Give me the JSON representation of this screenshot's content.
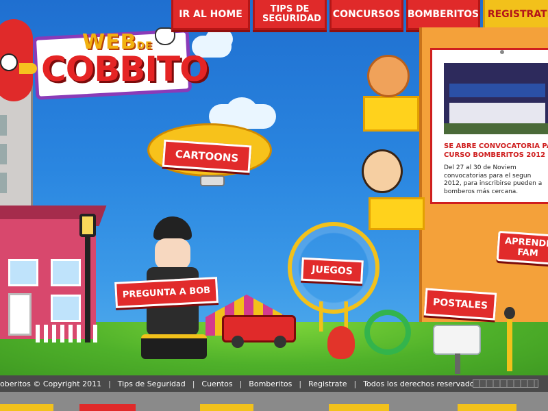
{
  "nav": {
    "items": [
      {
        "label": "IR AL HOME"
      },
      {
        "label": "TIPS DE SEGURIDAD"
      },
      {
        "label": "CONCURSOS"
      },
      {
        "label": "BOMBERITOS"
      },
      {
        "label": "REGISTRATE"
      }
    ]
  },
  "logo": {
    "web": "WEB",
    "de": "DE",
    "name": "COBBITO"
  },
  "signs": {
    "cartoons": "CARTOONS",
    "pregunta": "PREGUNTA A BOB",
    "juegos": "JUEGOS",
    "postales": "POSTALES",
    "aprende": "APRENDE FAM"
  },
  "news": {
    "title_line1": "SE ABRE CONVOCATORIA PA",
    "title_line2": "CURSO BOMBERITOS 2012",
    "body_lines": [
      "Del 27 al 30 de Noviem",
      "convocatorias para el segun",
      "2012, para inscribirse pueden a",
      "bomberos más cercana."
    ]
  },
  "footer": {
    "copyright": "oberitos © Copyright 2011",
    "links": [
      "Tips de Seguridad",
      "Cuentos",
      "Bomberitos",
      "Registrate"
    ],
    "rights": "Todos los derechos reservados"
  },
  "colors": {
    "red": "#e02a2a",
    "yellow": "#f2c11b",
    "sky": "#2a86e0",
    "orange": "#f4a13a"
  }
}
